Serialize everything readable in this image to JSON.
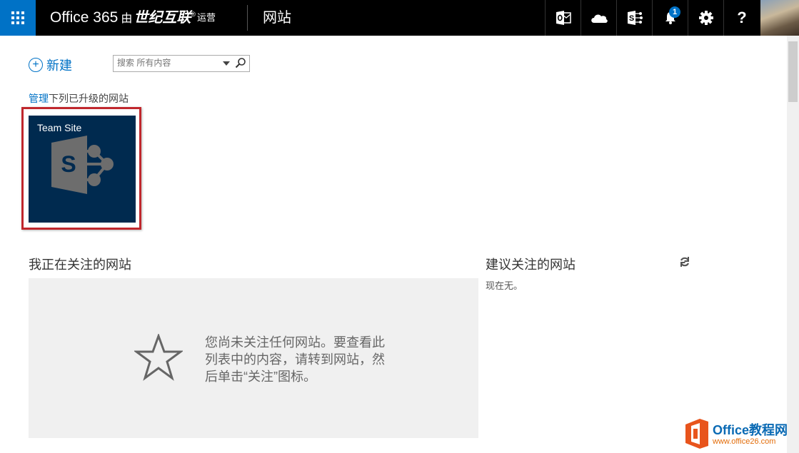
{
  "suite_bar": {
    "product": "Office 365",
    "by": "由",
    "operator": "世纪互联",
    "reg_mark": "®",
    "operated": "运营",
    "app_title": "网站",
    "notification_count": "1",
    "help_label": "?"
  },
  "commands": {
    "new_label": "新建",
    "search_placeholder": "搜索 所有内容"
  },
  "manage": {
    "link": "管理",
    "rest": "下列已升级的网站"
  },
  "tile": {
    "name": "Team Site",
    "logo_letter": "S"
  },
  "following": {
    "heading": "我正在关注的网站",
    "empty_message": "您尚未关注任何网站。要查看此列表中的内容，请转到网站，然后单击“关注”图标。"
  },
  "suggested": {
    "heading": "建议关注的网站",
    "none_text": "现在无。"
  },
  "watermark": {
    "title": "Office教程网",
    "url": "www.office26.com"
  },
  "colors": {
    "suite_bar": "#000000",
    "waffle": "#0072c6",
    "accent": "#0072c6",
    "tile_bg": "#002a4f",
    "highlight_border": "#c0272d"
  }
}
